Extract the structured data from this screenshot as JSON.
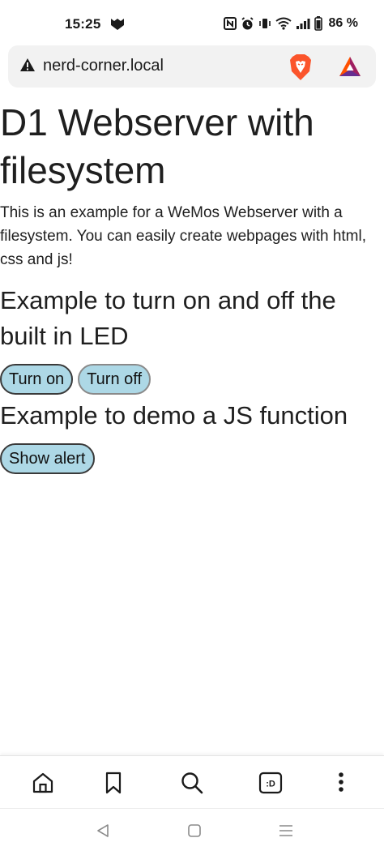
{
  "status_bar": {
    "time": "15:25",
    "battery": "86 %"
  },
  "address_bar": {
    "url": "nerd-corner.local"
  },
  "page": {
    "title": "D1 Webserver with filesystem",
    "intro": "This is an example for a WeMos Webserver with a filesystem. You can easily create webpages with html, css and js!",
    "led_section": {
      "heading": "Example to turn on and off the built in LED",
      "turn_on_label": "Turn on",
      "turn_off_label": "Turn off"
    },
    "js_section": {
      "heading": "Example to demo a JS function",
      "show_alert_label": "Show alert"
    }
  },
  "toolbar": {
    "items": [
      "home-icon",
      "bookmark-icon",
      "search-icon",
      "tabs-icon",
      "more-menu-icon"
    ],
    "tabs_label": ":D"
  },
  "system_nav": {
    "items": [
      "back-icon",
      "home-square-icon",
      "recents-menu-icon"
    ]
  },
  "colors": {
    "button_bg": "#add8e6",
    "brave_orange": "#fb542b",
    "text": "#1f1f1f"
  }
}
